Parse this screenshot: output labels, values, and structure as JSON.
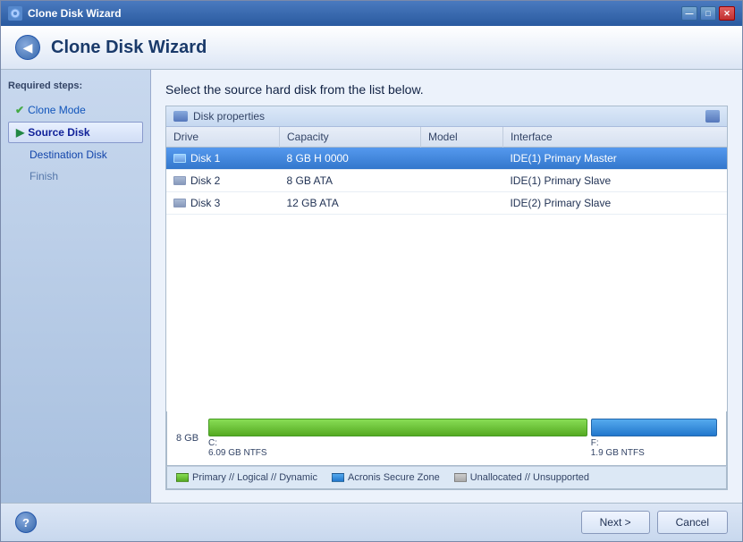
{
  "window": {
    "title": "Clone Disk Wizard",
    "controls": {
      "minimize": "—",
      "maximize": "□",
      "close": "✕"
    }
  },
  "header": {
    "title": "Clone Disk Wizard",
    "back_icon": "◀"
  },
  "sidebar": {
    "title": "Required steps:",
    "items": [
      {
        "id": "clone-mode",
        "label": "Clone Mode",
        "state": "completed"
      },
      {
        "id": "source-disk",
        "label": "Source Disk",
        "state": "active"
      },
      {
        "id": "destination-disk",
        "label": "Destination Disk",
        "state": "default"
      },
      {
        "id": "finish",
        "label": "Finish",
        "state": "disabled"
      }
    ]
  },
  "main": {
    "instruction": "Select the source hard disk from the list below.",
    "panel_title": "Disk properties",
    "table": {
      "columns": [
        "Drive",
        "Capacity",
        "Model",
        "Interface"
      ],
      "rows": [
        {
          "drive": "Disk 1",
          "capacity": "8 GB H 0000",
          "model": "",
          "interface": "IDE(1) Primary Master",
          "selected": true
        },
        {
          "drive": "Disk 2",
          "capacity": "8 GB ATA",
          "model": "",
          "interface": "IDE(1) Primary Slave",
          "selected": false
        },
        {
          "drive": "Disk 3",
          "capacity": "12 GB ATA",
          "model": "",
          "interface": "IDE(2) Primary Slave",
          "selected": false
        }
      ]
    },
    "disk_visual": {
      "size_label": "8 GB",
      "partitions": [
        {
          "label": "C:",
          "sub_label": "6.09 GB  NTFS",
          "type": "green",
          "size": "big"
        },
        {
          "label": "F:",
          "sub_label": "1.9 GB  NTFS",
          "type": "blue",
          "size": "small"
        }
      ]
    },
    "legend": [
      {
        "type": "green",
        "label": "Primary // Logical // Dynamic"
      },
      {
        "type": "blue",
        "label": "Acronis Secure Zone"
      },
      {
        "type": "gray",
        "label": "Unallocated // Unsupported"
      }
    ]
  },
  "footer": {
    "help_label": "?",
    "next_label": "Next >",
    "cancel_label": "Cancel"
  }
}
